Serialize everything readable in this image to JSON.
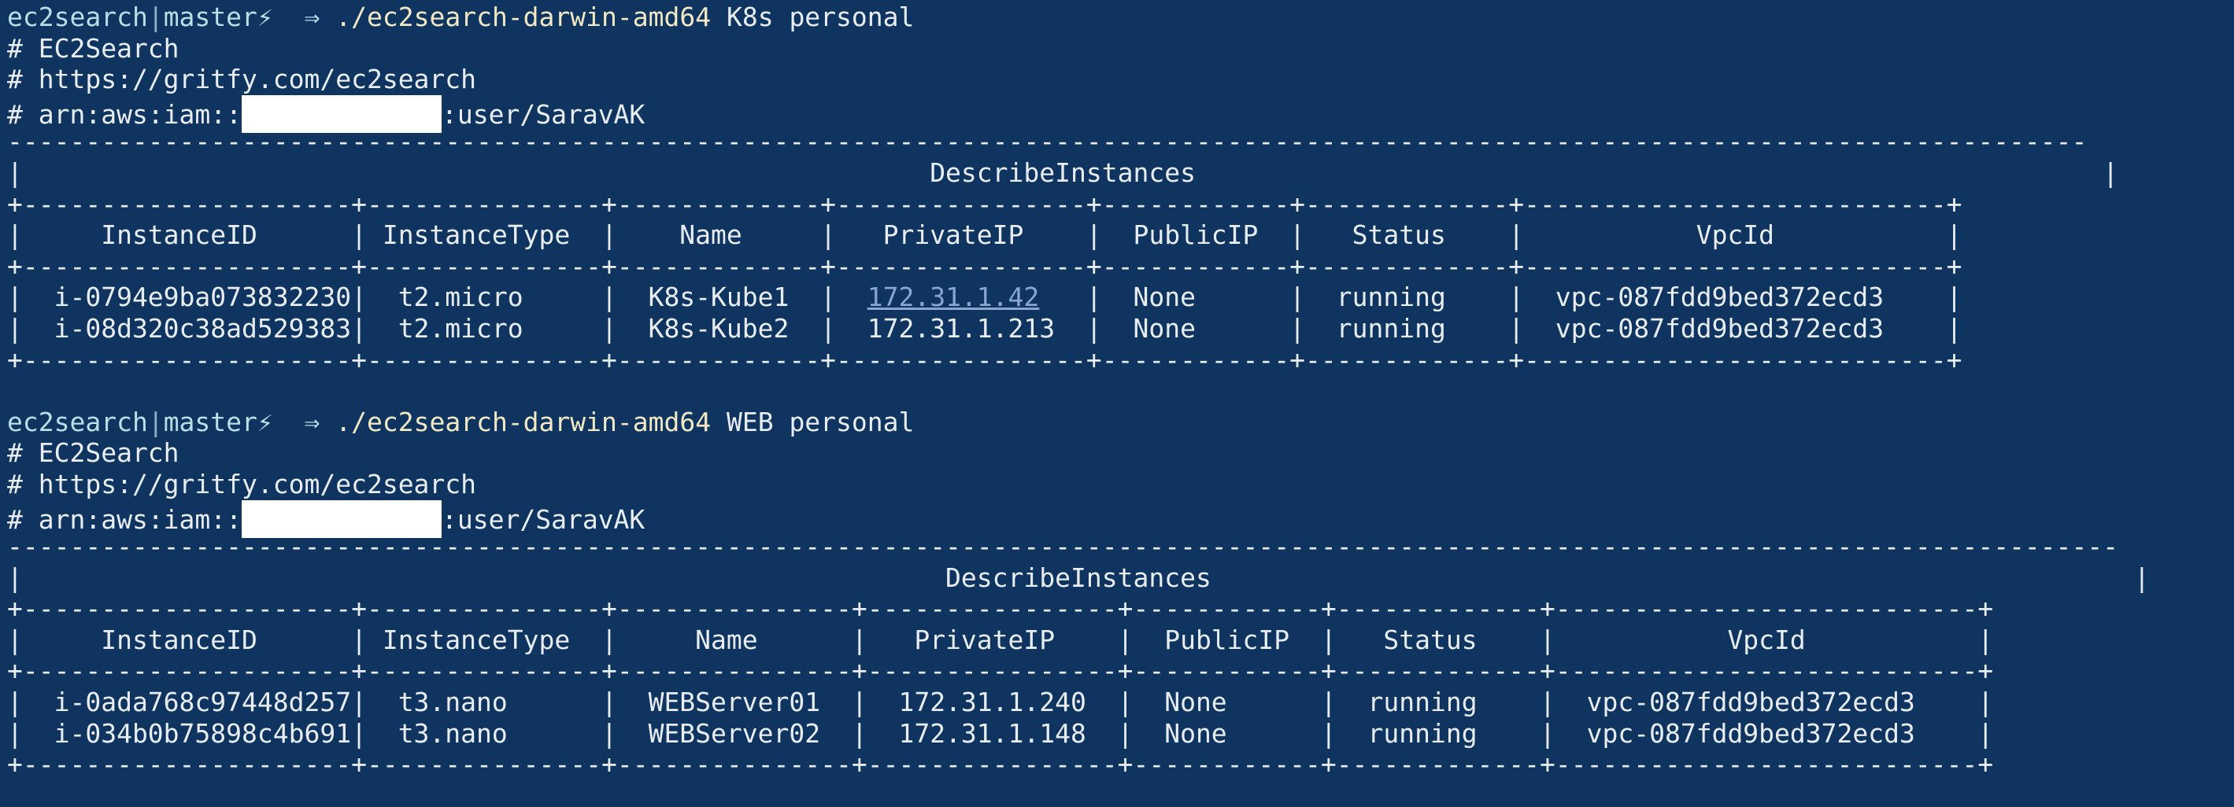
{
  "sessions": [
    {
      "prompt": {
        "dir": "ec2search",
        "sep": "|",
        "branch": "master⚡",
        "arrow": "⇒",
        "command": "./ec2search-darwin-amd64",
        "args": "K8s personal"
      },
      "header": {
        "title_line": "# EC2Search",
        "url_line": "# https://gritfy.com/ec2search",
        "arn_prefix": "# arn:aws:iam::",
        "arn_suffix": ":user/SaravAK"
      },
      "table": {
        "top_dash": "-------------------------------------------------------------------------------------------------------------------------------------",
        "title_row": "|                                                          DescribeInstances                                                          |",
        "sep": "+---------------------+---------------+-------------+----------------+------------+-------------+---------------------------+",
        "header_row": "|     InstanceID      | InstanceType  |    Name     |   PrivateIP    |  PublicIP  |   Status    |           VpcId           |",
        "rows": [
          {
            "p1": "|  i-0794e9ba073832230|  t2.micro     |  K8s-Kube1  |  ",
            "link": "172.31.1.42",
            "p2": "   |  None      |  running    |  vpc-087fdd9bed372ecd3    |"
          },
          {
            "p1": "|  i-08d320c38ad529383|  t2.micro     |  K8s-Kube2  |  172.31.1.213  |  None      |  running    |  vpc-087fdd9bed372ecd3    |",
            "link": "",
            "p2": ""
          }
        ]
      }
    },
    {
      "prompt": {
        "dir": "ec2search",
        "sep": "|",
        "branch": "master⚡",
        "arrow": "⇒",
        "command": "./ec2search-darwin-amd64",
        "args": "WEB personal"
      },
      "header": {
        "title_line": "# EC2Search",
        "url_line": "# https://gritfy.com/ec2search",
        "arn_prefix": "# arn:aws:iam::",
        "arn_suffix": ":user/SaravAK"
      },
      "table": {
        "top_dash": "---------------------------------------------------------------------------------------------------------------------------------------",
        "title_row": "|                                                           DescribeInstances                                                           |",
        "sep": "+---------------------+---------------+---------------+----------------+------------+-------------+---------------------------+",
        "header_row": "|     InstanceID      | InstanceType  |     Name      |   PrivateIP    |  PublicIP  |   Status    |           VpcId           |",
        "rows": [
          {
            "p1": "|  i-0ada768c97448d257|  t3.nano      |  WEBServer01  |  172.31.1.240  |  None      |  running    |  vpc-087fdd9bed372ecd3    |",
            "link": "",
            "p2": ""
          },
          {
            "p1": "|  i-034b0b75898c4b691|  t3.nano      |  WEBServer02  |  172.31.1.148  |  None      |  running    |  vpc-087fdd9bed372ecd3    |",
            "link": "",
            "p2": ""
          }
        ]
      }
    }
  ]
}
